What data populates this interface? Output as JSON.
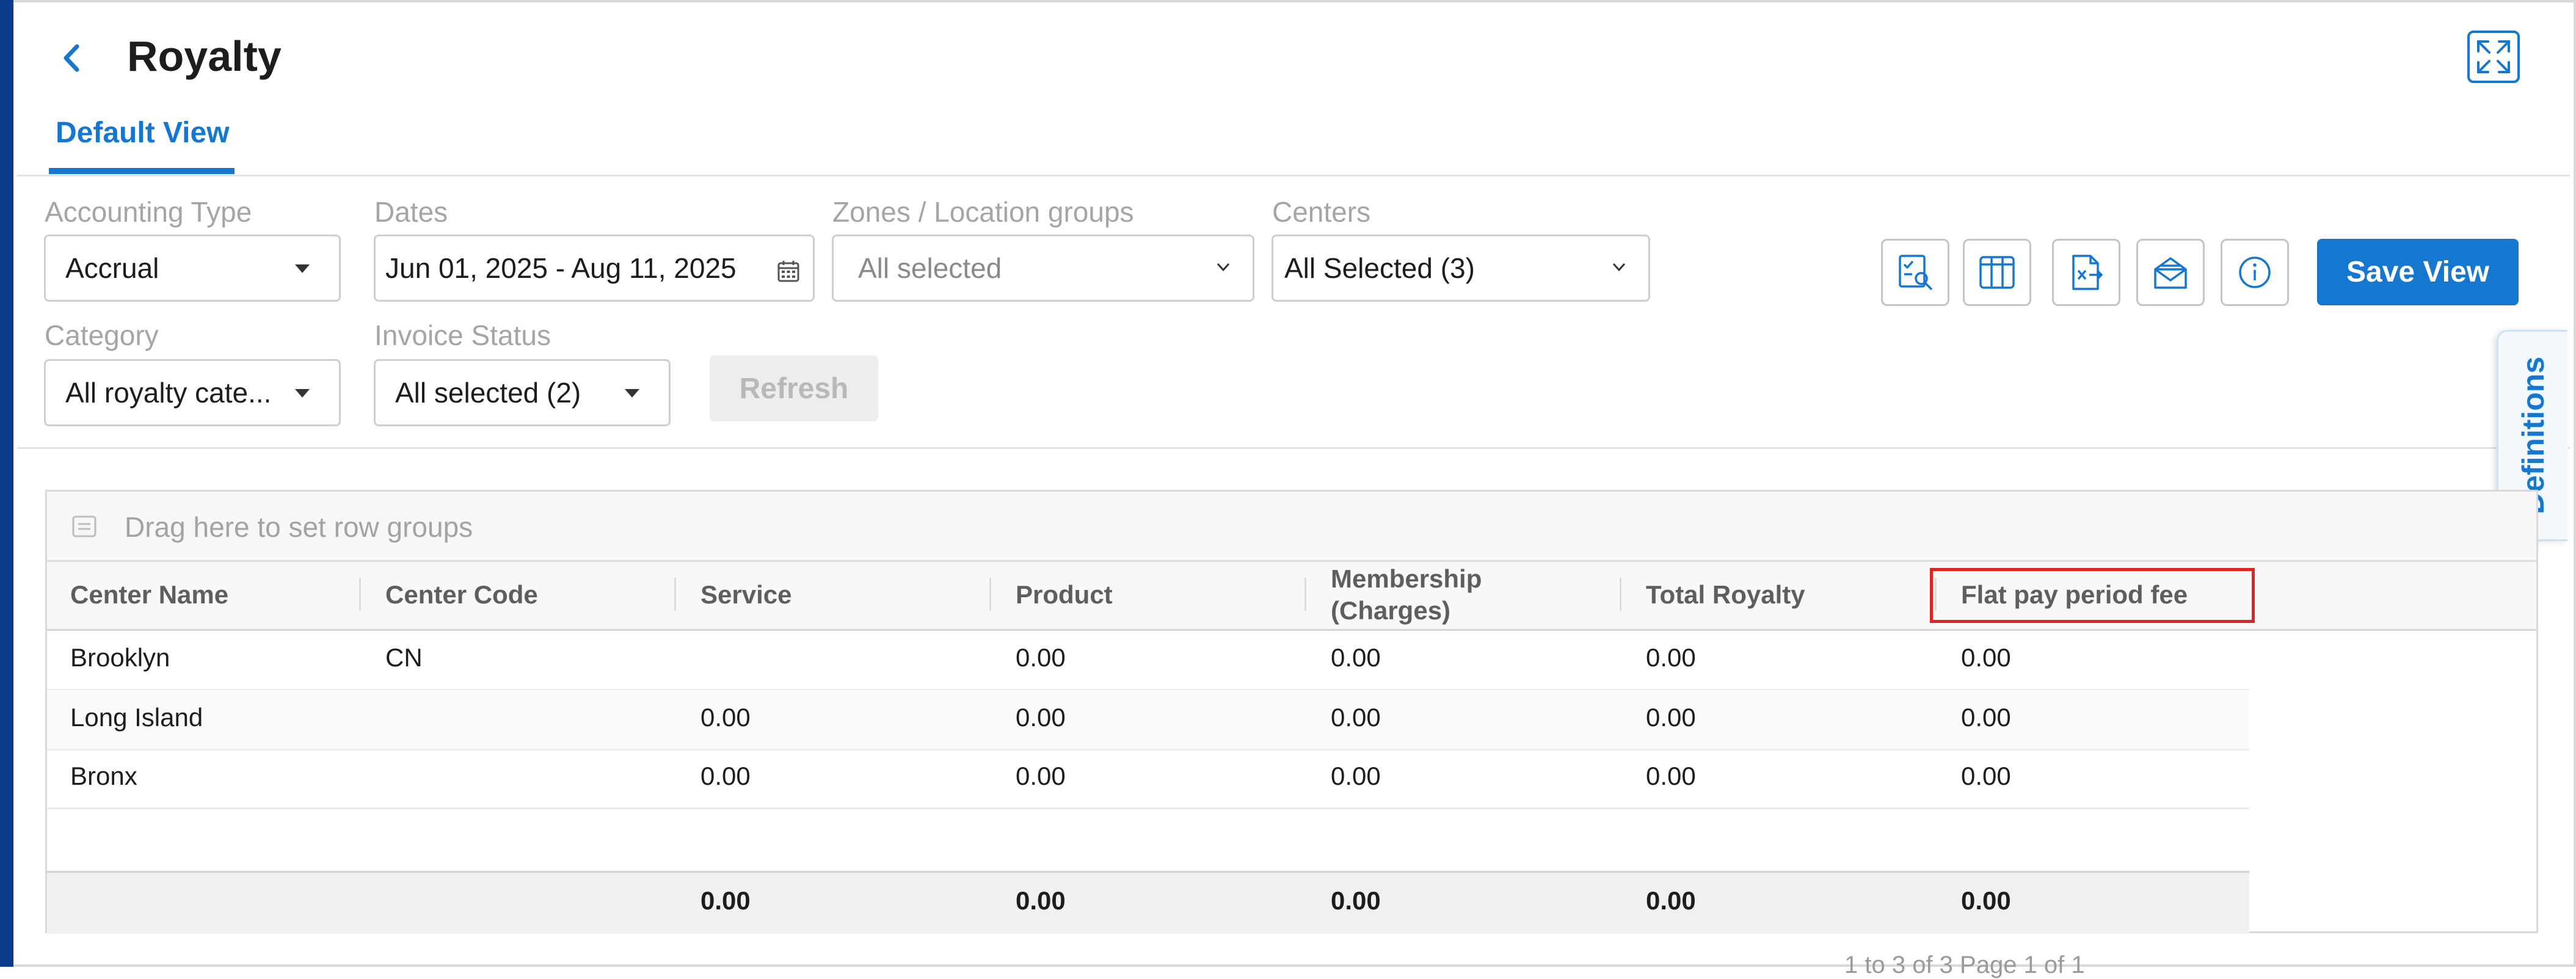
{
  "header": {
    "title": "Royalty"
  },
  "tabs": [
    {
      "label": "Default View"
    }
  ],
  "filters": {
    "accounting_type": {
      "label": "Accounting Type",
      "value": "Accrual"
    },
    "dates": {
      "label": "Dates",
      "value": "Jun 01, 2025 - Aug 11, 2025"
    },
    "zones": {
      "label": "Zones / Location groups",
      "placeholder": "All selected"
    },
    "centers": {
      "label": "Centers",
      "value": "All Selected (3)"
    },
    "category": {
      "label": "Category",
      "value": "All royalty cate..."
    },
    "invoice_status": {
      "label": "Invoice Status",
      "value": "All selected (2)"
    }
  },
  "buttons": {
    "refresh": "Refresh",
    "save_view": "Save View"
  },
  "side_tab": {
    "label": "Definitions"
  },
  "grid": {
    "group_hint": "Drag here to set row groups",
    "columns": [
      "Center Name",
      "Center Code",
      "Service",
      "Product",
      "Membership",
      "(Charges)",
      "Total Royalty",
      "Flat pay period fee"
    ],
    "rows": [
      {
        "center_name": "Brooklyn",
        "center_code": "CN",
        "service": "",
        "product": "0.00",
        "membership": "0.00",
        "total_royalty": "0.00",
        "flat_fee": "0.00"
      },
      {
        "center_name": "Long Island",
        "center_code": "",
        "service": "0.00",
        "product": "0.00",
        "membership": "0.00",
        "total_royalty": "0.00",
        "flat_fee": "0.00"
      },
      {
        "center_name": "Bronx",
        "center_code": "",
        "service": "0.00",
        "product": "0.00",
        "membership": "0.00",
        "total_royalty": "0.00",
        "flat_fee": "0.00"
      }
    ],
    "totals": {
      "service": "0.00",
      "product": "0.00",
      "membership": "0.00",
      "total_royalty": "0.00",
      "flat_fee": "0.00"
    },
    "pagination": "1 to 3 of 3    Page 1 of 1"
  },
  "colors": {
    "accent": "#1577d0",
    "nav": "#0d3b8c",
    "highlight": "#e02424"
  }
}
